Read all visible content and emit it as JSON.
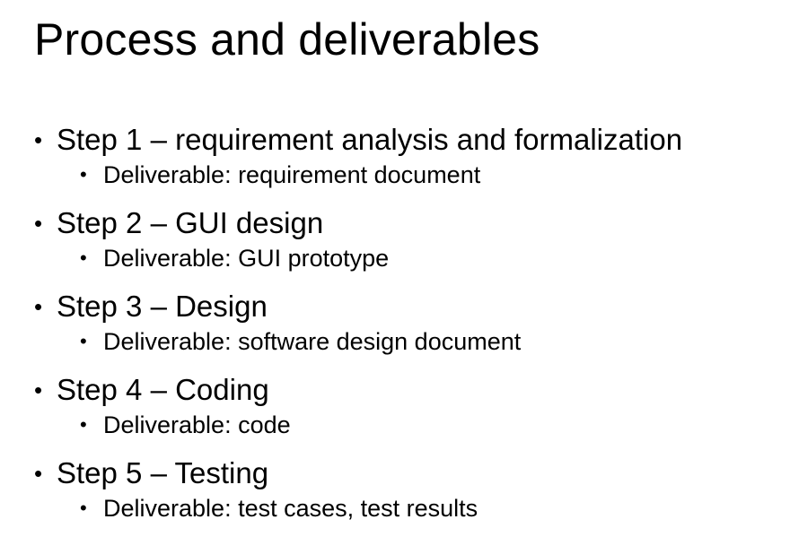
{
  "slide": {
    "title": "Process and deliverables",
    "bullet_glyph": "•",
    "steps": [
      {
        "label": "Step 1 – requirement analysis and formalization",
        "deliverable": "Deliverable: requirement document"
      },
      {
        "label": "Step 2 – GUI design",
        "deliverable": "Deliverable: GUI prototype"
      },
      {
        "label": "Step 3 – Design",
        "deliverable": "Deliverable: software design document"
      },
      {
        "label": "Step 4 – Coding",
        "deliverable": "Deliverable: code"
      },
      {
        "label": "Step 5 – Testing",
        "deliverable": "Deliverable: test cases, test results"
      }
    ]
  }
}
